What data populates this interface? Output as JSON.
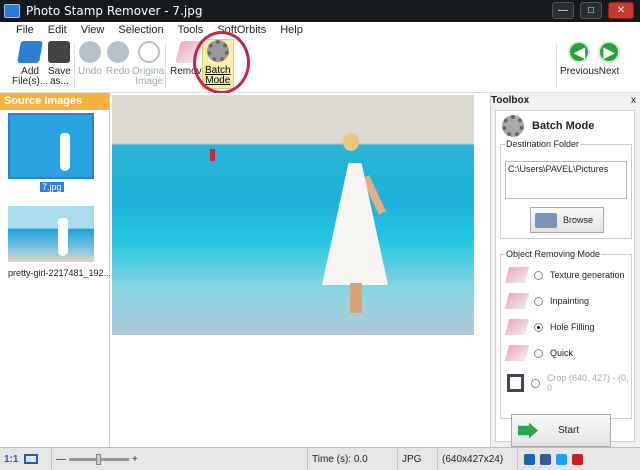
{
  "window": {
    "title": "Photo Stamp Remover - 7.jpg"
  },
  "menu": [
    "File",
    "Edit",
    "View",
    "Selection",
    "Tools",
    "SoftOrbits",
    "Help"
  ],
  "toolbar": {
    "add": "Add\nFile(s)...",
    "save": "Save\nas...",
    "undo": "Undo",
    "redo": "Redo",
    "original": "Original\nImage",
    "remove": "Remove",
    "batch": "Batch\nMode",
    "previous": "Previous",
    "next": "Next"
  },
  "source_images": {
    "title": "Source Images",
    "items": [
      {
        "name": "7.jpg",
        "selected": true
      },
      {
        "name": "pretty-girl-2217481_192..."
      }
    ]
  },
  "toolbox": {
    "title": "Toolbox",
    "close": "x",
    "mode_title": "Batch Mode",
    "destination_label": "Destination Folder",
    "destination_path": "C:\\Users\\PAVEL\\Pictures",
    "browse": "Browse",
    "removing_mode_label": "Object Removing Mode",
    "options": [
      "Texture generation",
      "Inpainting",
      "Hole Filling",
      "Quick"
    ],
    "selected_option": "Hole Filling",
    "crop": "Crop (640, 427) - (0, 0",
    "start": "Start"
  },
  "status": {
    "zoom": "1:1",
    "time": "Time (s): 0.0",
    "format": "JPG",
    "dims": "(640x427x24)"
  },
  "colors": {
    "accent": "#f5b041",
    "highlight_ring": "#c52350",
    "nav_green": "#27a33a"
  }
}
